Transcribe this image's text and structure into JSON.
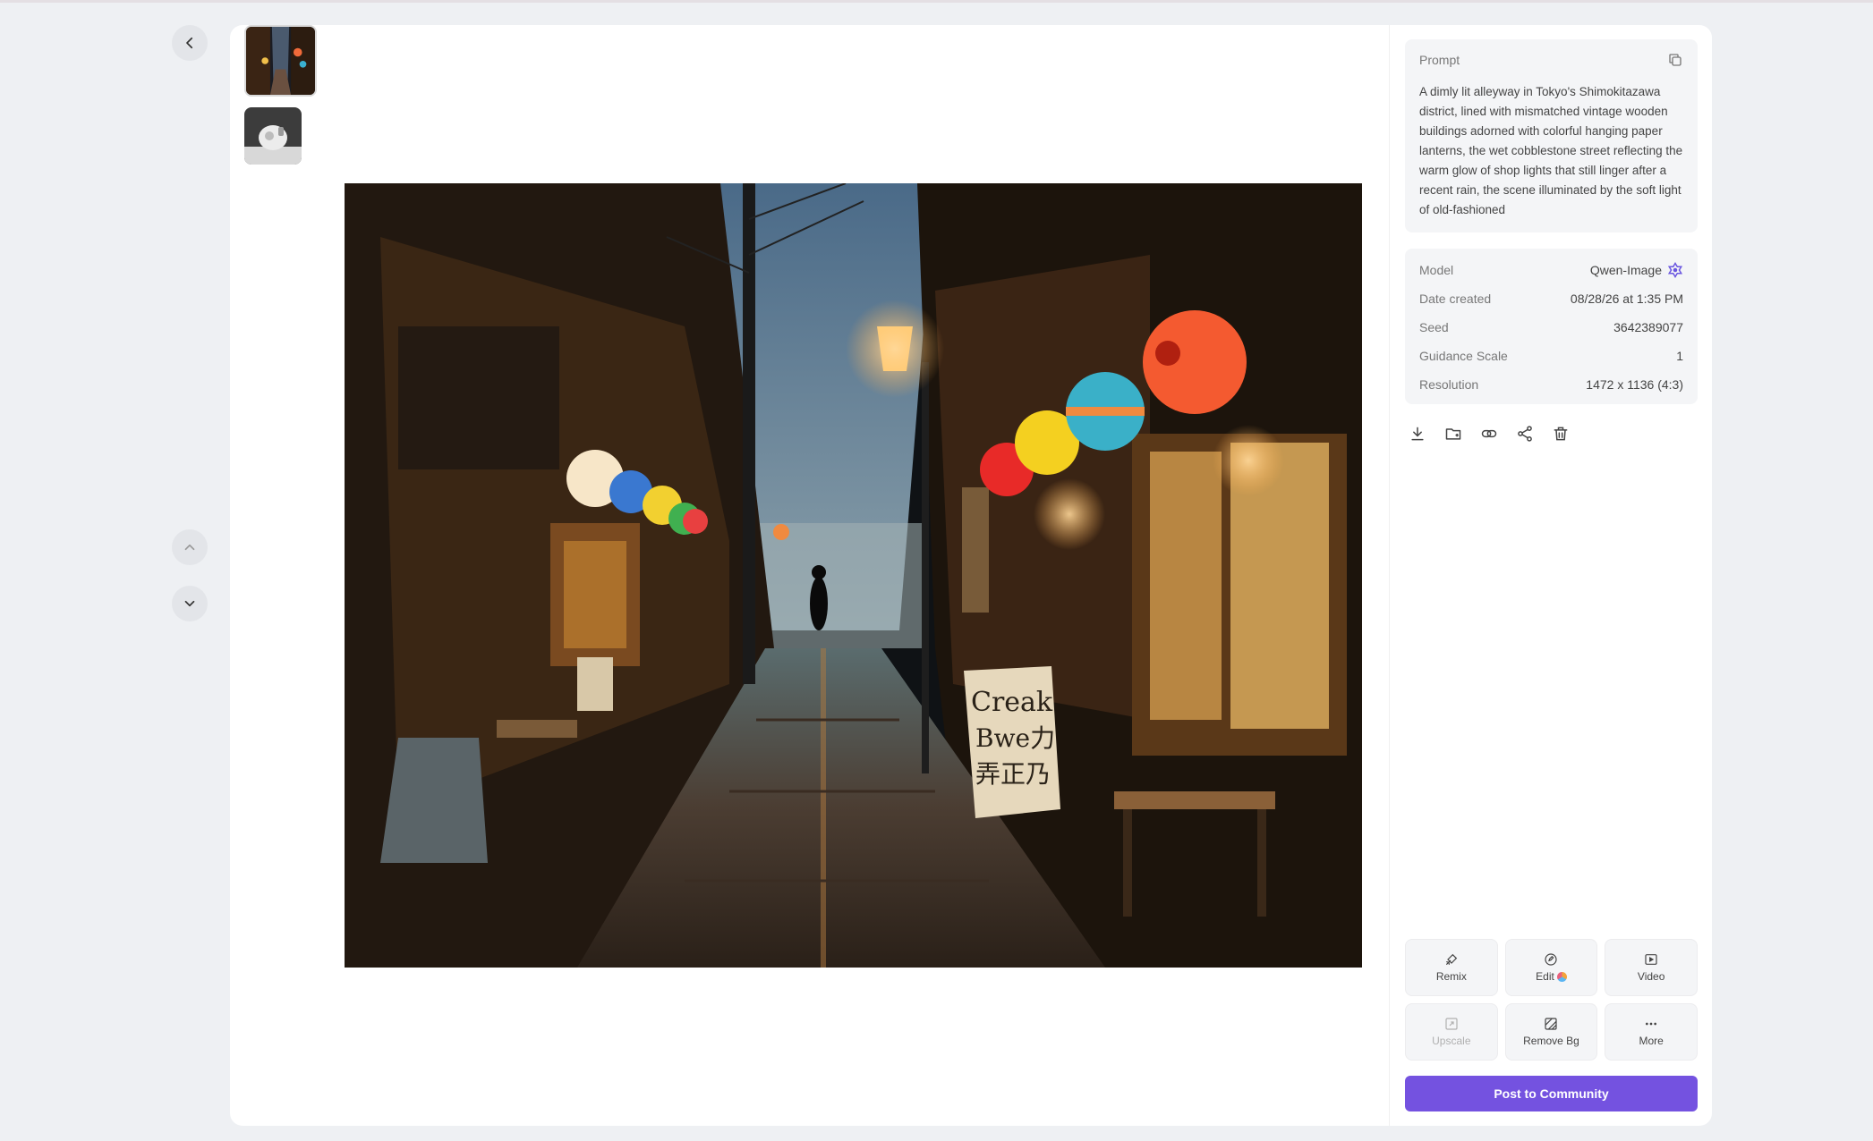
{
  "navigation": {
    "back_icon": "chevron-left-icon",
    "prev_icon": "chevron-up-icon",
    "next_icon": "chevron-down-icon"
  },
  "thumbnails": [
    {
      "subject": "night alley with lanterns"
    },
    {
      "subject": "white product on dark background"
    }
  ],
  "sign_text": [
    "Creak",
    "Bwe力",
    "弄正乃"
  ],
  "prompt": {
    "label": "Prompt",
    "text": "A dimly lit alleyway in Tokyo's Shimokitazawa district, lined with mismatched vintage wooden buildings adorned with colorful hanging paper lanterns, the wet cobblestone street reflecting the warm glow of shop lights that still linger after a recent rain, the scene illuminated by the soft light of old-fashioned",
    "copy_icon": "copy-icon"
  },
  "meta": {
    "model_label": "Model",
    "model_value": "Qwen-Image",
    "date_label": "Date created",
    "date_value": "08/28/26 at 1:35 PM",
    "seed_label": "Seed",
    "seed_value": "3642389077",
    "guidance_label": "Guidance Scale",
    "guidance_value": "1",
    "resolution_label": "Resolution",
    "resolution_value": "1472 x 1136 (4:3)"
  },
  "actions": [
    "download-icon",
    "add-to-folder-icon",
    "link-icon",
    "share-icon",
    "trash-icon"
  ],
  "tools": {
    "remix": "Remix",
    "edit": "Edit",
    "video": "Video",
    "upscale": "Upscale",
    "remove_bg": "Remove Bg",
    "more": "More"
  },
  "post_button": "Post to Community",
  "colors": {
    "accent": "#7452e0",
    "panel": "#f4f5f7",
    "background": "#eef0f3"
  }
}
